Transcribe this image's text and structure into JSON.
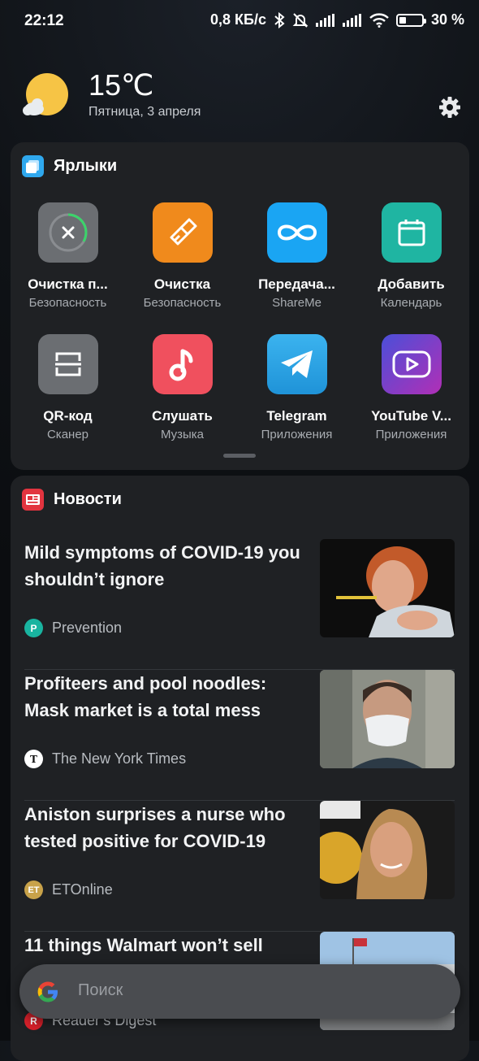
{
  "status": {
    "time": "22:12",
    "net_speed": "0,8 КБ/с",
    "battery_text": "30 %",
    "battery_level": 0.3
  },
  "weather": {
    "temperature": "15℃",
    "date": "Пятница, 3 апреля",
    "icon": "partly-cloudy-icon"
  },
  "shortcuts": {
    "title": "Ярлыки",
    "apps": [
      {
        "name": "Очистка п...",
        "sub": "Безопасность",
        "icon": "cleaner-icon",
        "color": "#6b6e72"
      },
      {
        "name": "Очистка",
        "sub": "Безопасность",
        "icon": "broom-icon",
        "color": "#f08a1c"
      },
      {
        "name": "Передача...",
        "sub": "ShareMe",
        "icon": "infinity-icon",
        "color": "#1aa5f3"
      },
      {
        "name": "Добавить",
        "sub": "Календарь",
        "icon": "calendar-icon",
        "color": "#1fb5a2"
      },
      {
        "name": "QR-код",
        "sub": "Сканер",
        "icon": "scanner-icon",
        "color": "#6b6e72"
      },
      {
        "name": "Слушать",
        "sub": "Музыка",
        "icon": "music-icon",
        "color": "#f0505e"
      },
      {
        "name": "Telegram",
        "sub": "Приложения",
        "icon": "telegram-icon",
        "color": "#2ea6e6"
      },
      {
        "name": "YouTube V...",
        "sub": "Приложения",
        "icon": "youtube-vanced-icon",
        "color": "#9a3fd6"
      }
    ]
  },
  "news": {
    "title": "Новости",
    "items": [
      {
        "title": "Mild symptoms of COVID-19 you shouldn’t ignore",
        "source": "Prevention",
        "logo_letter": "P",
        "logo_color": "#19b4a0"
      },
      {
        "title": "Profiteers and pool noodles: Mask market is a total mess",
        "source": "The New York Times",
        "logo_letter": "T",
        "logo_color": "#ffffff"
      },
      {
        "title": "Aniston surprises a nurse who tested positive for COVID-19",
        "source": "ETOnline",
        "logo_letter": "ET",
        "logo_color": "#c8a24a"
      },
      {
        "title": "11 things Walmart won’t sell",
        "source": "Reader’s Digest",
        "logo_letter": "R",
        "logo_color": "#d6202a"
      }
    ]
  },
  "search": {
    "placeholder": "Поиск"
  }
}
